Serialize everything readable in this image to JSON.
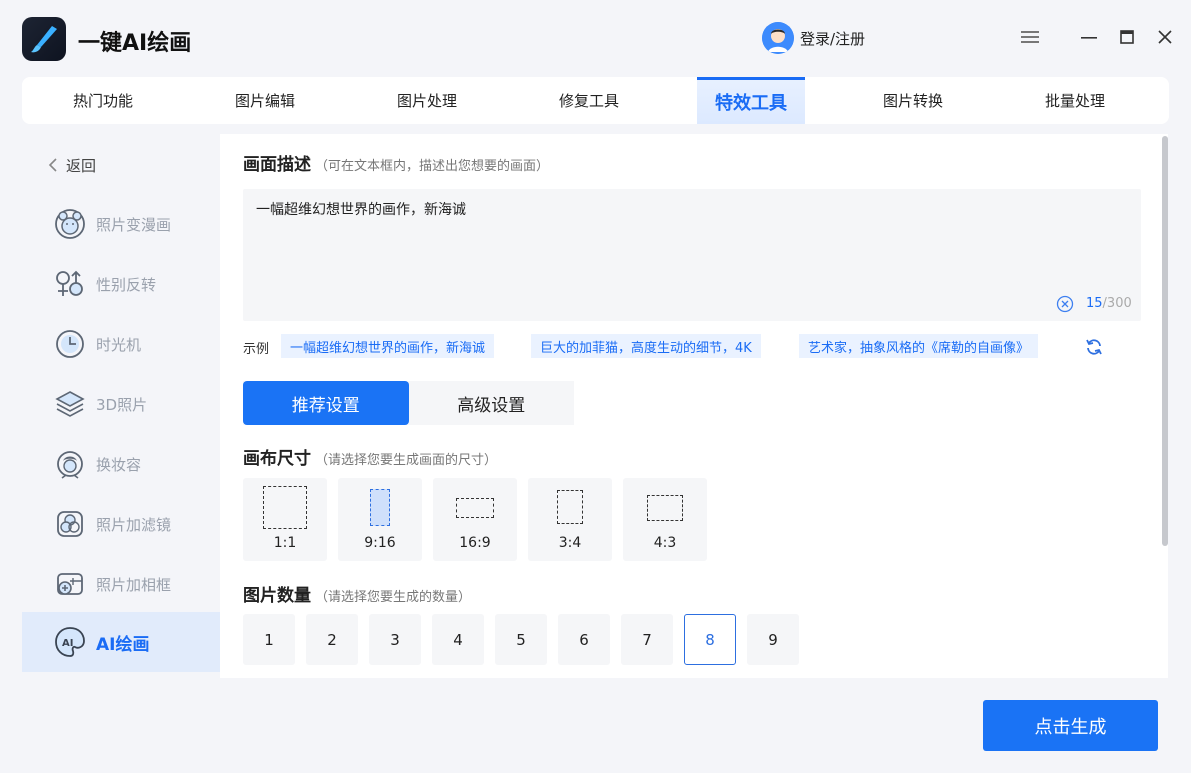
{
  "app": {
    "title": "一键AI绘画"
  },
  "user": {
    "login_label": "登录/注册"
  },
  "tabs": [
    {
      "label": "热门功能"
    },
    {
      "label": "图片编辑"
    },
    {
      "label": "图片处理"
    },
    {
      "label": "修复工具"
    },
    {
      "label": "特效工具",
      "active": true
    },
    {
      "label": "图片转换"
    },
    {
      "label": "批量处理"
    }
  ],
  "sidebar": {
    "back_label": "返回",
    "items": [
      {
        "label": "照片变漫画",
        "icon": "bear-face-icon"
      },
      {
        "label": "性别反转",
        "icon": "gender-icon"
      },
      {
        "label": "时光机",
        "icon": "clock-icon"
      },
      {
        "label": "3D照片",
        "icon": "layers-icon"
      },
      {
        "label": "换妆容",
        "icon": "face-makeup-icon"
      },
      {
        "label": "照片加滤镜",
        "icon": "filter-icon"
      },
      {
        "label": "照片加相框",
        "icon": "frame-add-icon"
      },
      {
        "label": "AI绘画",
        "icon": "ai-paint-icon",
        "active": true
      }
    ]
  },
  "description": {
    "title": "画面描述",
    "hint": "（可在文本框内，描述出您想要的画面）",
    "value": "一幅超维幻想世界的画作，新海诚",
    "count": "15",
    "max": "/300"
  },
  "examples": {
    "label": "示例",
    "items": [
      "一幅超维幻想世界的画作，新海诚",
      "巨大的加菲猫，高度生动的细节，4K",
      "艺术家，抽象风格的《席勒的自画像》"
    ]
  },
  "modes": {
    "recommended": "推荐设置",
    "advanced": "高级设置"
  },
  "canvas": {
    "title": "画布尺寸",
    "hint": "（请选择您要生成画面的尺寸）",
    "options": [
      "1:1",
      "9:16",
      "16:9",
      "3:4",
      "4:3"
    ],
    "selected": "9:16"
  },
  "quantity": {
    "title": "图片数量",
    "hint": "（请选择您要生成的数量）",
    "options": [
      "1",
      "2",
      "3",
      "4",
      "5",
      "6",
      "7",
      "8",
      "9"
    ],
    "selected": "8"
  },
  "generate_label": "点击生成",
  "colors": {
    "accent": "#1a73f5",
    "selected_tint": "#e1ebfb"
  }
}
